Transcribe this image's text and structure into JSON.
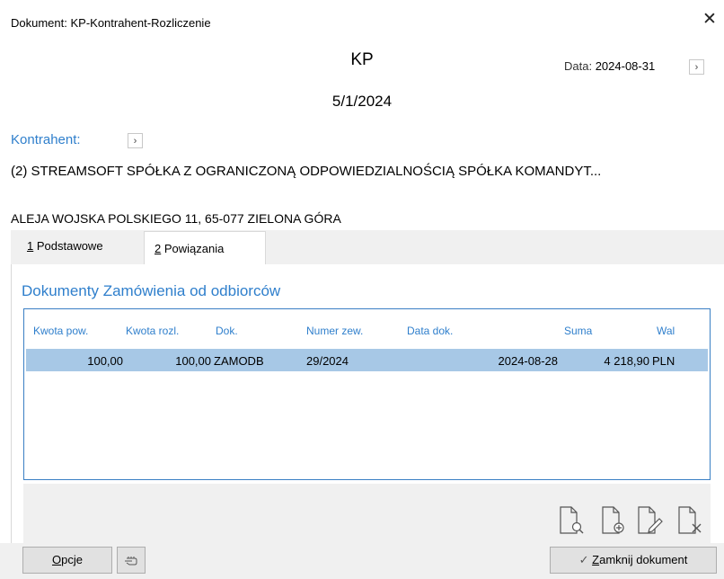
{
  "window": {
    "title": "Dokument: KP-Kontrahent-Rozliczenie",
    "close_glyph": "✕"
  },
  "document": {
    "type": "KP",
    "number": "5/1/2024",
    "date_label": "Data:",
    "date_value": "2024-08-31"
  },
  "kontrahent": {
    "label": "Kontrahent:",
    "name": "(2) STREAMSOFT SPÓŁKA Z OGRANICZONĄ ODPOWIEDZIALNOŚCIĄ SPÓŁKA KOMANDYT...",
    "address": "ALEJA WOJSKA POLSKIEGO 11, 65-077 ZIELONA GÓRA"
  },
  "tabs": [
    {
      "key": "1",
      "label": " Podstawowe"
    },
    {
      "key": "2",
      "label": " Powiązania"
    }
  ],
  "section": {
    "title": "Dokumenty Zamówienia od odbiorców",
    "columns": [
      "Kwota pow.",
      "Kwota rozl.",
      "Dok.",
      "Numer zew.",
      "Data dok.",
      "Suma",
      "Wal"
    ],
    "rows": [
      {
        "kwota_pow": "100,00",
        "kwota_rozl": "100,00",
        "dok": "ZAMODB",
        "numer_zew": "29/2024",
        "data_dok": "2024-08-28",
        "suma": "4 218,90",
        "wal": "PLN"
      }
    ]
  },
  "toolbar_icons": [
    "preview-document-icon",
    "add-document-icon",
    "edit-document-icon",
    "delete-document-icon"
  ],
  "footer": {
    "opcje_key": "O",
    "opcje_rest": "pcje",
    "close_check": "✓",
    "close_key": "Z",
    "close_rest": "amknij dokument"
  },
  "colors": {
    "accent": "#2f7fcc",
    "selected_row": "#a7c8e6",
    "grid_border": "#3a7fc4"
  }
}
